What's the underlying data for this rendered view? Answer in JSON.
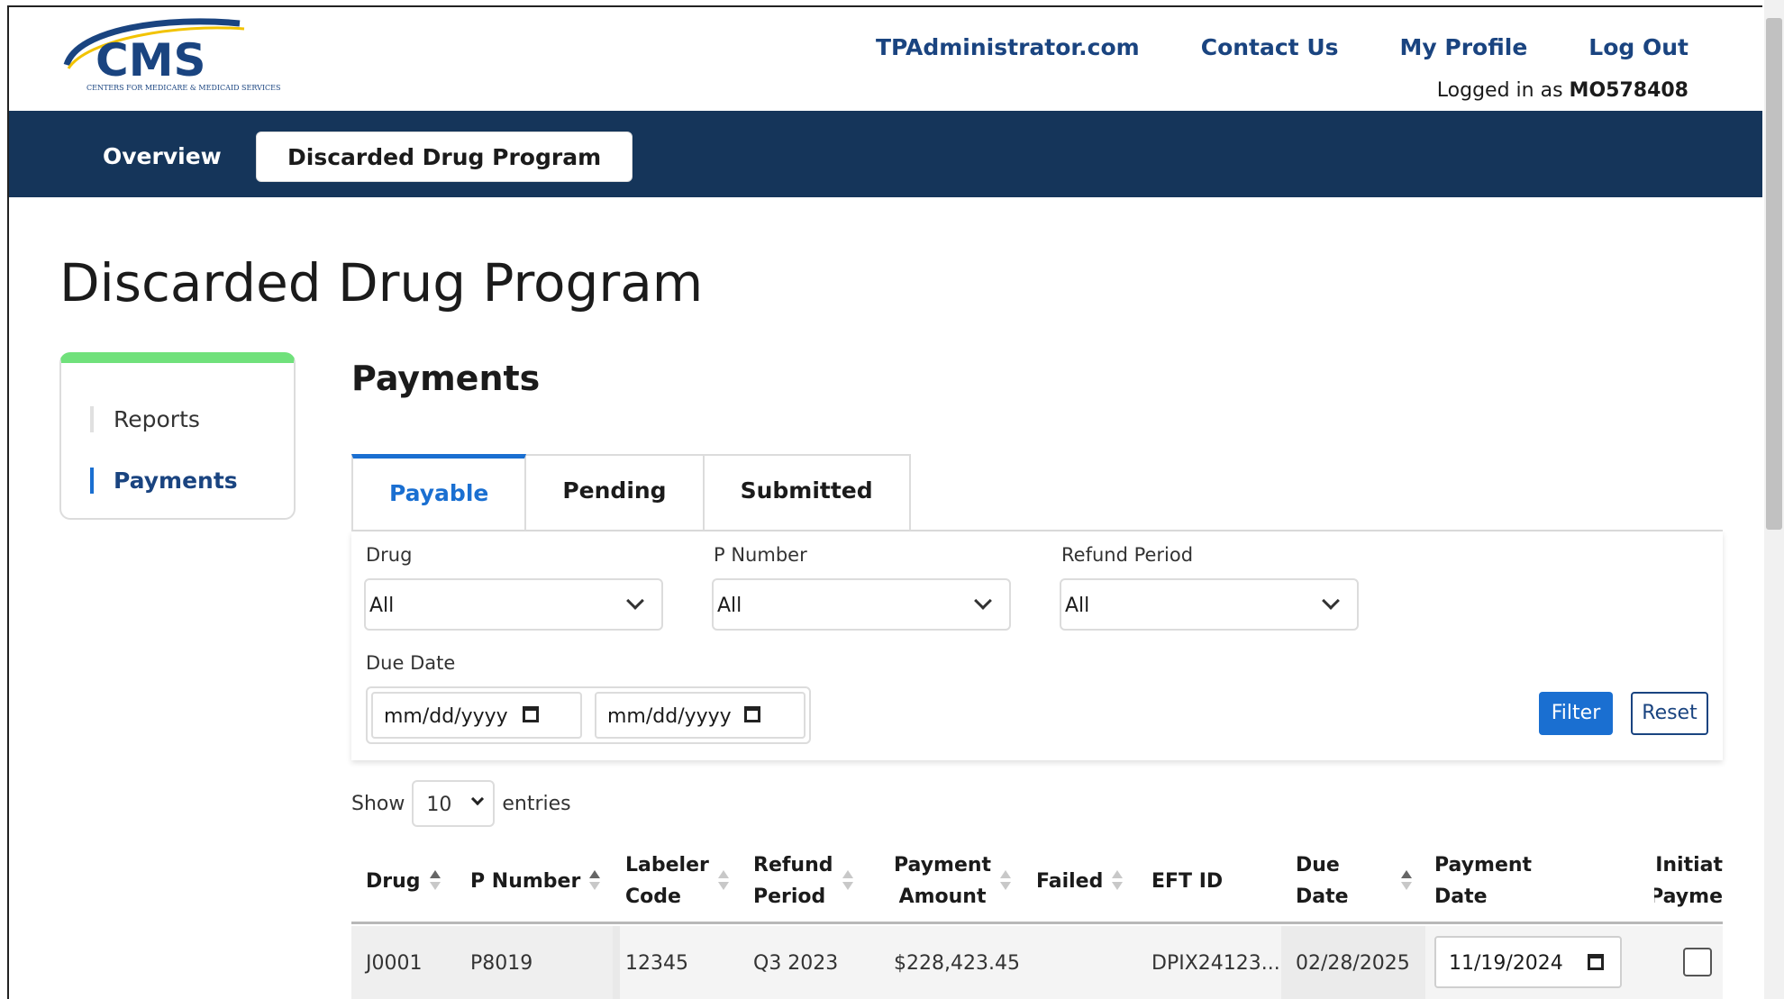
{
  "header": {
    "logo_main": "CMS",
    "logo_sub": "CENTERS FOR MEDICARE & MEDICAID SERVICES",
    "nav": [
      {
        "label": "TPAdministrator.com"
      },
      {
        "label": "Contact Us"
      },
      {
        "label": "My Profile"
      },
      {
        "label": "Log Out"
      }
    ],
    "logged_in_prefix": "Logged in as",
    "username": "MO578408"
  },
  "navbar": {
    "tabs": [
      "Overview",
      "Discarded Drug Program"
    ],
    "active": "Discarded Drug Program"
  },
  "page": {
    "title": "Discarded Drug Program"
  },
  "sidebar": {
    "items": [
      {
        "label": "Reports",
        "active": false
      },
      {
        "label": "Payments",
        "active": true
      }
    ]
  },
  "section": {
    "title": "Payments",
    "tabs": [
      "Payable",
      "Pending",
      "Submitted"
    ],
    "active_tab": "Payable"
  },
  "filters": {
    "drug_label": "Drug",
    "drug_value": "All",
    "pnumber_label": "P Number",
    "pnumber_value": "All",
    "refund_label": "Refund Period",
    "refund_value": "All",
    "due_date_label": "Due Date",
    "due_from_placeholder": "mm/dd/yyyy",
    "due_to_placeholder": "mm/dd/yyyy",
    "filter_button": "Filter",
    "reset_button": "Reset"
  },
  "entries": {
    "show_label": "Show",
    "value": "10",
    "suffix": "entries"
  },
  "table": {
    "columns": [
      {
        "line1": "Drug",
        "line2": ""
      },
      {
        "line1": "P Number",
        "line2": ""
      },
      {
        "line1": "Labeler",
        "line2": "Code"
      },
      {
        "line1": "Refund",
        "line2": "Period"
      },
      {
        "line1": "Payment",
        "line2": "Amount"
      },
      {
        "line1": "Failed",
        "line2": ""
      },
      {
        "line1": "EFT ID",
        "line2": ""
      },
      {
        "line1": "Due",
        "line2": "Date"
      },
      {
        "line1": "Payment",
        "line2": "Date"
      },
      {
        "line1": "Initiat",
        "line2": "Payme"
      }
    ],
    "rows": [
      {
        "drug": "J0001",
        "p_number": "P8019",
        "labeler_code": "12345",
        "refund_period": "Q3 2023",
        "payment_amount": "$228,423.45",
        "failed": "",
        "eft_id": "DPIX24123...",
        "due_date": "02/28/2025",
        "payment_date": "11/19/2024"
      }
    ]
  },
  "colors": {
    "navbar": "#15355a",
    "link": "#1a4480",
    "accent": "#1a6fd1",
    "sidebar_top": "#70e17b"
  }
}
